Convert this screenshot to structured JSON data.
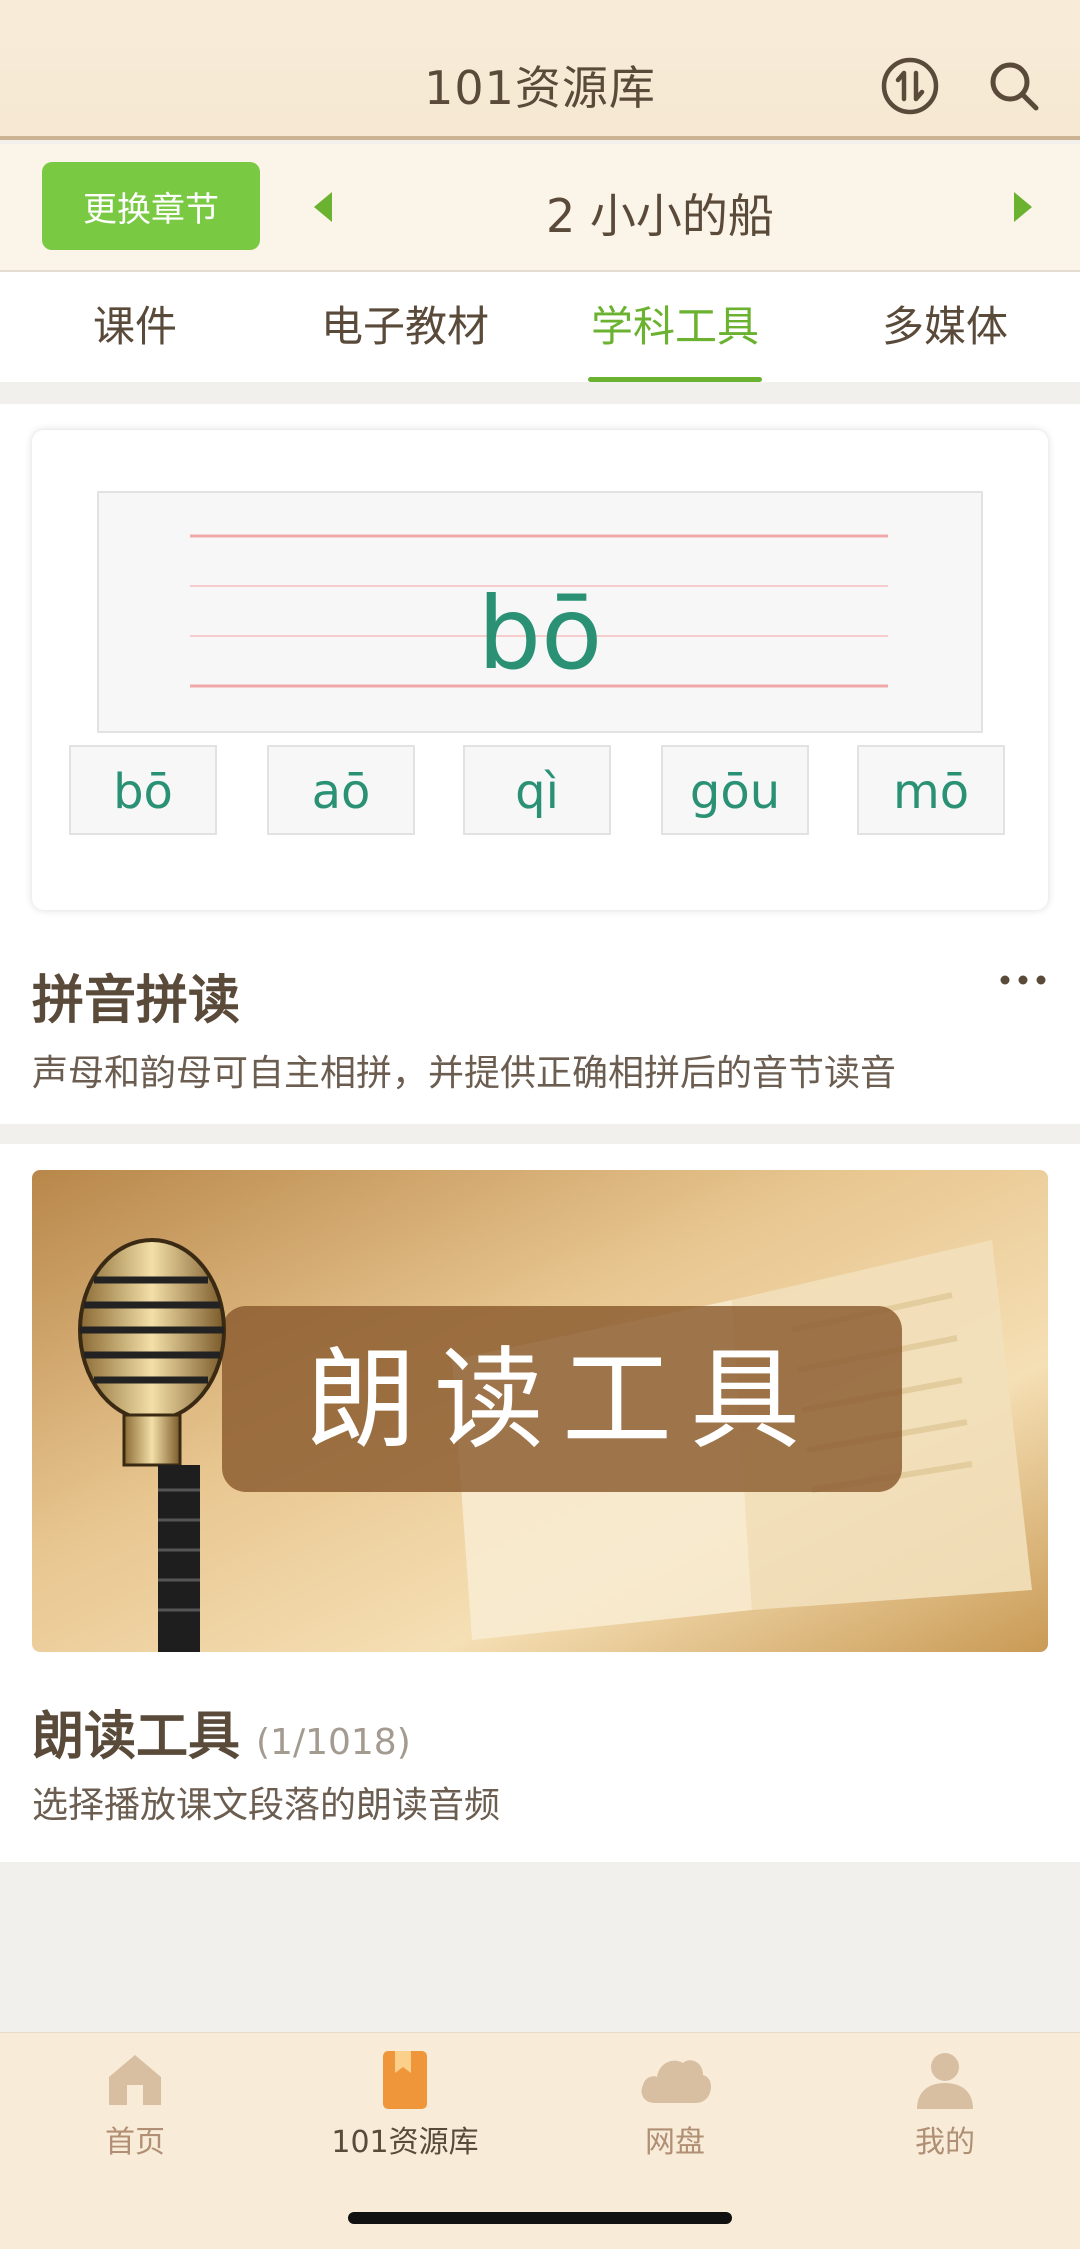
{
  "header": {
    "title": "101资源库",
    "switch_icon": "switch-icon",
    "search_icon": "search-icon"
  },
  "chapter": {
    "change_label": "更换章节",
    "title": "2 小小的船"
  },
  "tabs": [
    {
      "label": "课件"
    },
    {
      "label": "电子教材"
    },
    {
      "label": "学科工具",
      "active": true
    },
    {
      "label": "多媒体"
    }
  ],
  "cards": [
    {
      "title": "拼音拼读",
      "description": "声母和韵母可自主相拼，并提供正确相拼后的音节读音",
      "preview": {
        "main_syllable": "bō",
        "syllables": [
          "bō",
          "aō",
          "qì",
          "gōu",
          "mō"
        ]
      }
    },
    {
      "title": "朗读工具",
      "count": "(1/1018)",
      "description": "选择播放课文段落的朗读音频",
      "banner_text": "朗读工具"
    }
  ],
  "tabbar": [
    {
      "label": "首页",
      "icon": "home-icon"
    },
    {
      "label": "101资源库",
      "icon": "library-icon",
      "active": true
    },
    {
      "label": "网盘",
      "icon": "cloud-icon"
    },
    {
      "label": "我的",
      "icon": "user-icon"
    }
  ],
  "colors": {
    "accent": "#6ab22f",
    "button": "#7ac943",
    "header_bg": "#f8ecd9",
    "text": "#5a4a3a"
  }
}
